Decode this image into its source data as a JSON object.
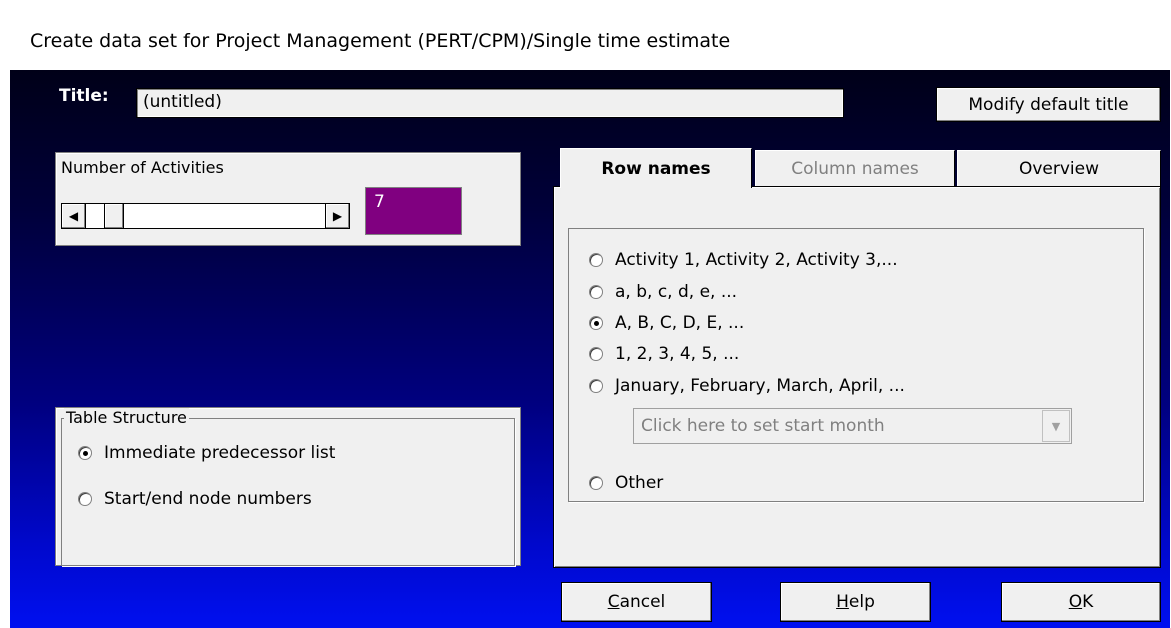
{
  "window": {
    "title": "Create data set for Project Management (PERT/CPM)/Single time estimate"
  },
  "title_field": {
    "label": "Title:",
    "value": "(untitled)"
  },
  "buttons": {
    "modify": "Modify default title",
    "cancel_first": "C",
    "cancel_rest": "ancel",
    "help_first": "H",
    "help_rest": "elp",
    "ok_first": "O",
    "ok_rest": "K"
  },
  "activities": {
    "label": "Number of Activities",
    "count": "7",
    "scroll_left": "◀",
    "scroll_right": "▶"
  },
  "table_structure": {
    "legend": "Table Structure",
    "options": [
      {
        "label": "Immediate predecessor list",
        "selected": true
      },
      {
        "label": "Start/end node numbers",
        "selected": false
      }
    ]
  },
  "tabs": [
    {
      "label": "Row names",
      "active": true
    },
    {
      "label": "Column names",
      "active": false
    },
    {
      "label": "Overview",
      "active": false
    }
  ],
  "row_names": {
    "options": [
      {
        "label": "Activity 1, Activity 2, Activity 3,...",
        "selected": false
      },
      {
        "label": "a, b, c, d, e, ...",
        "selected": false
      },
      {
        "label": "A, B, C, D, E, ...",
        "selected": true
      },
      {
        "label": "1, 2, 3, 4, 5, ...",
        "selected": false
      },
      {
        "label": "January, February, March, April, ...",
        "selected": false
      },
      {
        "label": "Other",
        "selected": false
      }
    ],
    "month_placeholder": "Click here to set start month",
    "combo_arrow": "▼"
  },
  "colors": {
    "count_bg": "#800080",
    "dialog_top": "#000018",
    "dialog_bottom": "#0010f0"
  }
}
